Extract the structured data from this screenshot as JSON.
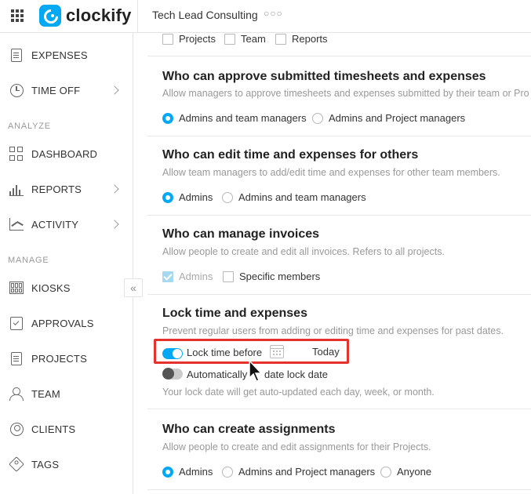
{
  "header": {
    "logo_text": "clockify",
    "workspace": "Tech Lead Consulting",
    "more": "○○○"
  },
  "sidebar": {
    "items_top": [
      {
        "label": "EXPENSES",
        "icon": "expenses-icon"
      },
      {
        "label": "TIME OFF",
        "icon": "time-off-icon",
        "chevron": true
      }
    ],
    "analyze_label": "ANALYZE",
    "analyze": [
      {
        "label": "DASHBOARD",
        "icon": "dashboard-icon"
      },
      {
        "label": "REPORTS",
        "icon": "reports-icon",
        "chevron": true
      },
      {
        "label": "ACTIVITY",
        "icon": "activity-icon",
        "chevron": true
      }
    ],
    "manage_label": "MANAGE",
    "manage": [
      {
        "label": "KIOSKS",
        "icon": "kiosk-icon"
      },
      {
        "label": "APPROVALS",
        "icon": "approvals-icon"
      },
      {
        "label": "PROJECTS",
        "icon": "projects-icon"
      },
      {
        "label": "TEAM",
        "icon": "team-icon"
      },
      {
        "label": "CLIENTS",
        "icon": "clients-icon"
      },
      {
        "label": "TAGS",
        "icon": "tags-icon"
      }
    ],
    "collapse_glyph": "«"
  },
  "main": {
    "top_checks": [
      {
        "label": "Projects",
        "checked": false
      },
      {
        "label": "Team",
        "checked": false
      },
      {
        "label": "Reports",
        "checked": false
      }
    ],
    "approve": {
      "title": "Who can approve submitted timesheets and expenses",
      "desc": "Allow managers to approve timesheets and expenses submitted by their team or Pro",
      "options": [
        {
          "label": "Admins and team managers",
          "selected": true
        },
        {
          "label": "Admins and Project managers",
          "selected": false
        }
      ]
    },
    "edit_others": {
      "title": "Who can edit time and expenses for others",
      "desc": "Allow team managers to add/edit time and expenses for other team members.",
      "options": [
        {
          "label": "Admins",
          "selected": true
        },
        {
          "label": "Admins and team managers",
          "selected": false
        }
      ]
    },
    "invoices": {
      "title": "Who can manage invoices",
      "desc": "Allow people to create and edit all invoices. Refers to all projects.",
      "options": [
        {
          "label": "Admins",
          "checked": true,
          "disabled": true
        },
        {
          "label": "Specific members",
          "checked": false
        }
      ]
    },
    "lock": {
      "title": "Lock time and expenses",
      "desc": "Prevent regular users from adding or editing time and expenses for past dates.",
      "lock_toggle_label": "Lock time before",
      "lock_toggle_on": true,
      "lock_date": "Today",
      "auto_label_a": "Automatically",
      "auto_label_b": "date lock date",
      "auto_toggle_on": false,
      "auto_hint": "Your lock date will get auto-updated each day, week, or month."
    },
    "assignments": {
      "title": "Who can create assignments",
      "desc": "Allow people to create and edit assignments for their Projects.",
      "options": [
        {
          "label": "Admins",
          "selected": true
        },
        {
          "label": "Admins and Project managers",
          "selected": false
        },
        {
          "label": "Anyone",
          "selected": false
        }
      ]
    }
  },
  "colors": {
    "accent": "#03a9f4",
    "highlight_box": "#e5322d"
  }
}
